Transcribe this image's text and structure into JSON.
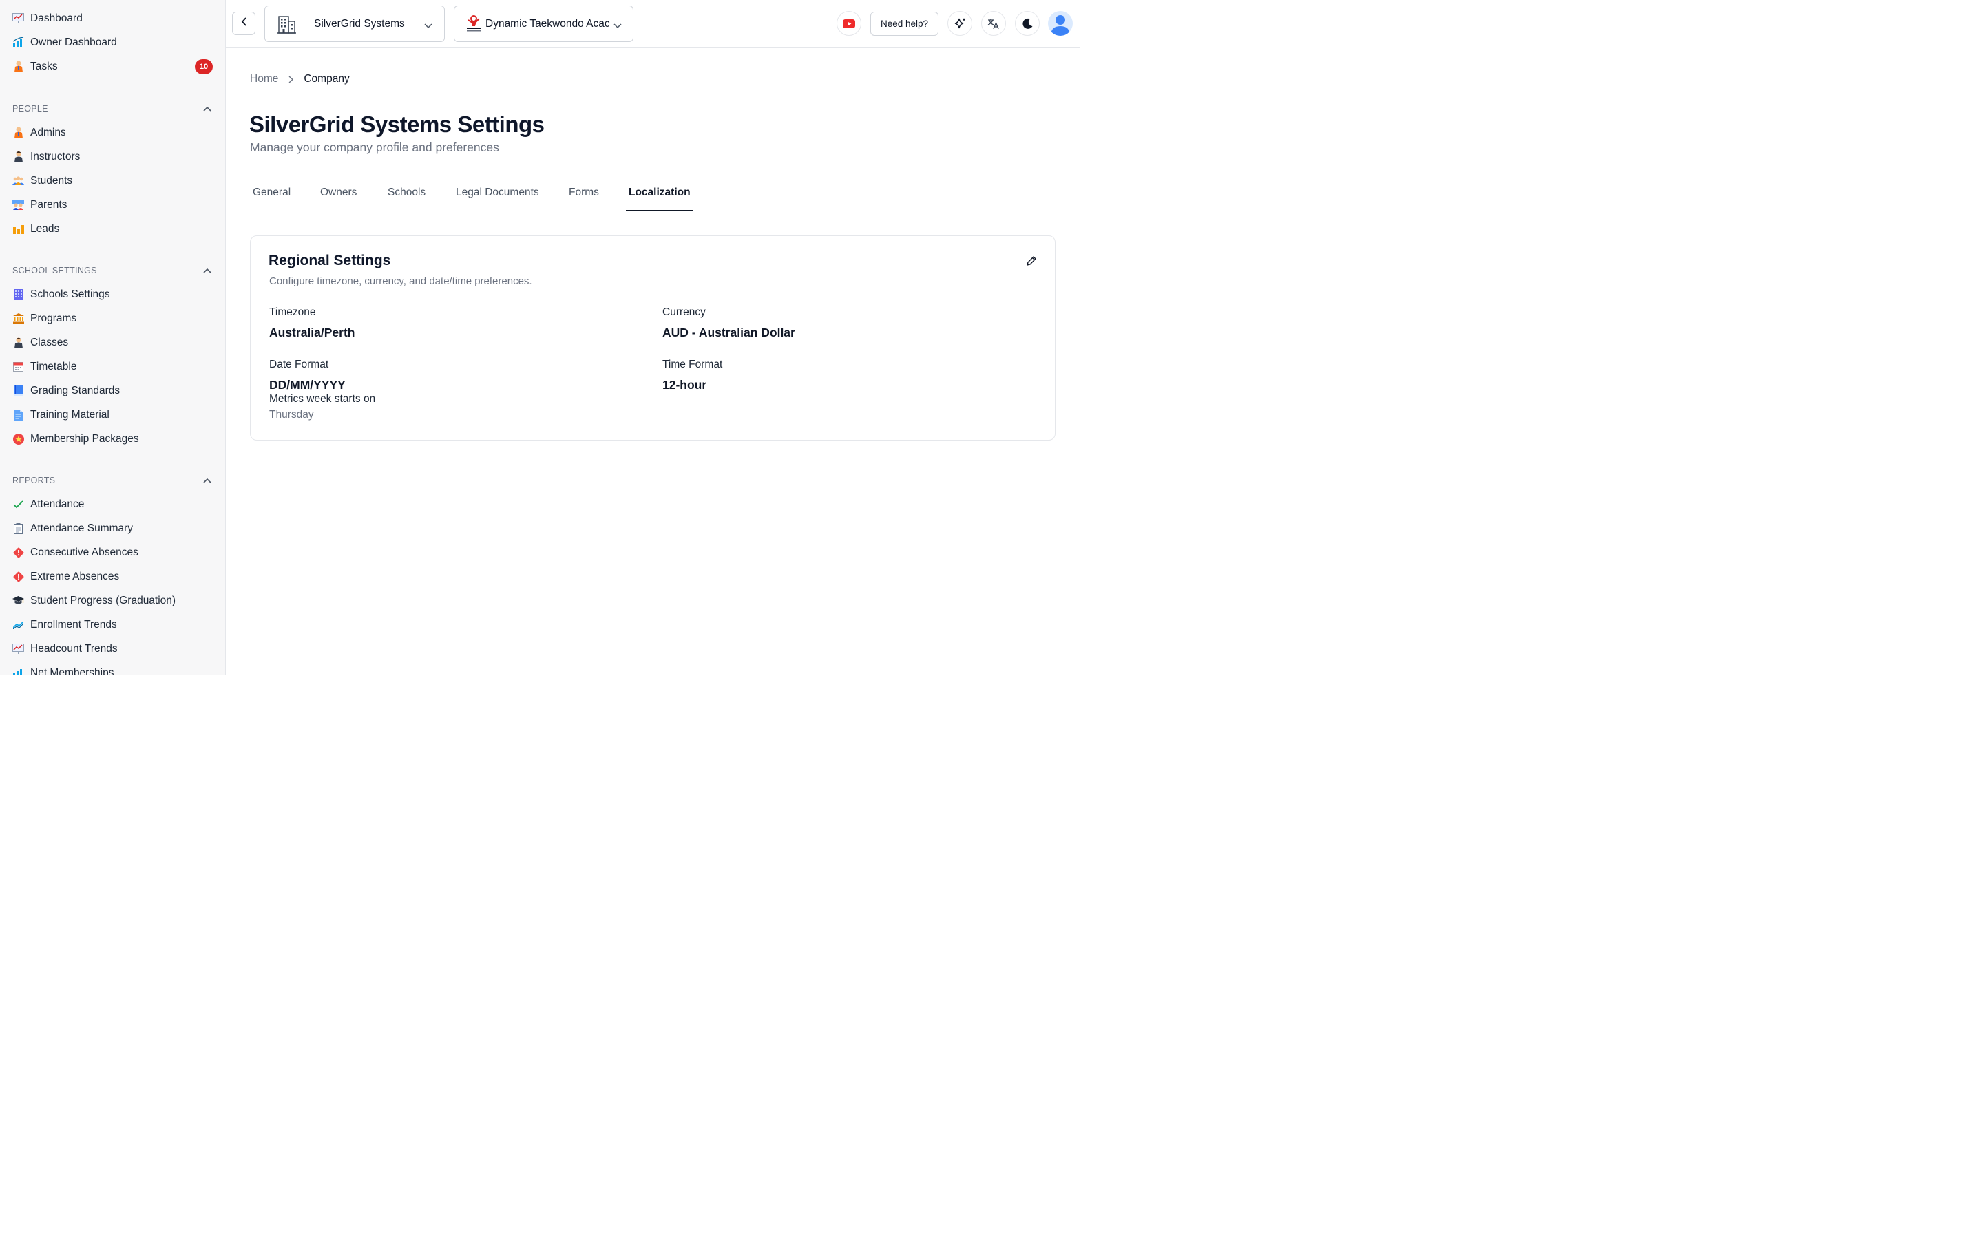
{
  "sidebar": {
    "top_items": [
      {
        "label": "Dashboard",
        "icon": "chart-up-icon"
      },
      {
        "label": "Owner Dashboard",
        "icon": "bar-chart-icon"
      },
      {
        "label": "Tasks",
        "icon": "person-icon",
        "badge": "10"
      }
    ],
    "people": {
      "title": "PEOPLE",
      "items": [
        {
          "label": "Admins",
          "icon": "admin-person-icon"
        },
        {
          "label": "Instructors",
          "icon": "instructor-icon"
        },
        {
          "label": "Students",
          "icon": "group-icon"
        },
        {
          "label": "Parents",
          "icon": "family-icon"
        },
        {
          "label": "Leads",
          "icon": "bar-chart-yellow-icon"
        }
      ]
    },
    "school_settings": {
      "title": "SCHOOL SETTINGS",
      "items": [
        {
          "label": "Schools Settings",
          "icon": "building-icon"
        },
        {
          "label": "Programs",
          "icon": "classical-building-icon"
        },
        {
          "label": "Classes",
          "icon": "teacher-icon"
        },
        {
          "label": "Timetable",
          "icon": "calendar-icon"
        },
        {
          "label": "Grading Standards",
          "icon": "book-icon"
        },
        {
          "label": "Training Material",
          "icon": "document-icon"
        },
        {
          "label": "Membership Packages",
          "icon": "star-badge-icon"
        }
      ]
    },
    "reports": {
      "title": "REPORTS",
      "items": [
        {
          "label": "Attendance",
          "icon": "check-icon"
        },
        {
          "label": "Attendance Summary",
          "icon": "clipboard-icon"
        },
        {
          "label": "Consecutive Absences",
          "icon": "warning-icon"
        },
        {
          "label": "Extreme Absences",
          "icon": "warning-icon"
        },
        {
          "label": "Student Progress (Graduation)",
          "icon": "graduation-cap-icon"
        },
        {
          "label": "Enrollment Trends",
          "icon": "trend-line-icon"
        },
        {
          "label": "Headcount Trends",
          "icon": "chart-up-icon"
        },
        {
          "label": "Net Memberships",
          "icon": "bar-chart-icon"
        }
      ]
    }
  },
  "topbar": {
    "company_name": "SilverGrid Systems",
    "school_name": "Dynamic Taekwondo Acac",
    "help_label": "Need help?"
  },
  "breadcrumb": {
    "home": "Home",
    "current": "Company"
  },
  "page": {
    "title": "SilverGrid Systems Settings",
    "subtitle": "Manage your company profile and preferences"
  },
  "tabs": [
    "General",
    "Owners",
    "Schools",
    "Legal Documents",
    "Forms",
    "Localization"
  ],
  "active_tab": "Localization",
  "card": {
    "title": "Regional Settings",
    "subtitle": "Configure timezone, currency, and date/time preferences.",
    "timezone_label": "Timezone",
    "timezone_value": "Australia/Perth",
    "currency_label": "Currency",
    "currency_value": "AUD - Australian Dollar",
    "date_format_label": "Date Format",
    "date_format_value": "DD/MM/YYYY",
    "time_format_label": "Time Format",
    "time_format_value": "12-hour",
    "week_start_label": "Metrics week starts on",
    "week_start_value": "Thursday"
  },
  "colors": {
    "badge": "#dc2626",
    "youtube": "#ef2b2b",
    "avatar": "#3b82f6"
  }
}
